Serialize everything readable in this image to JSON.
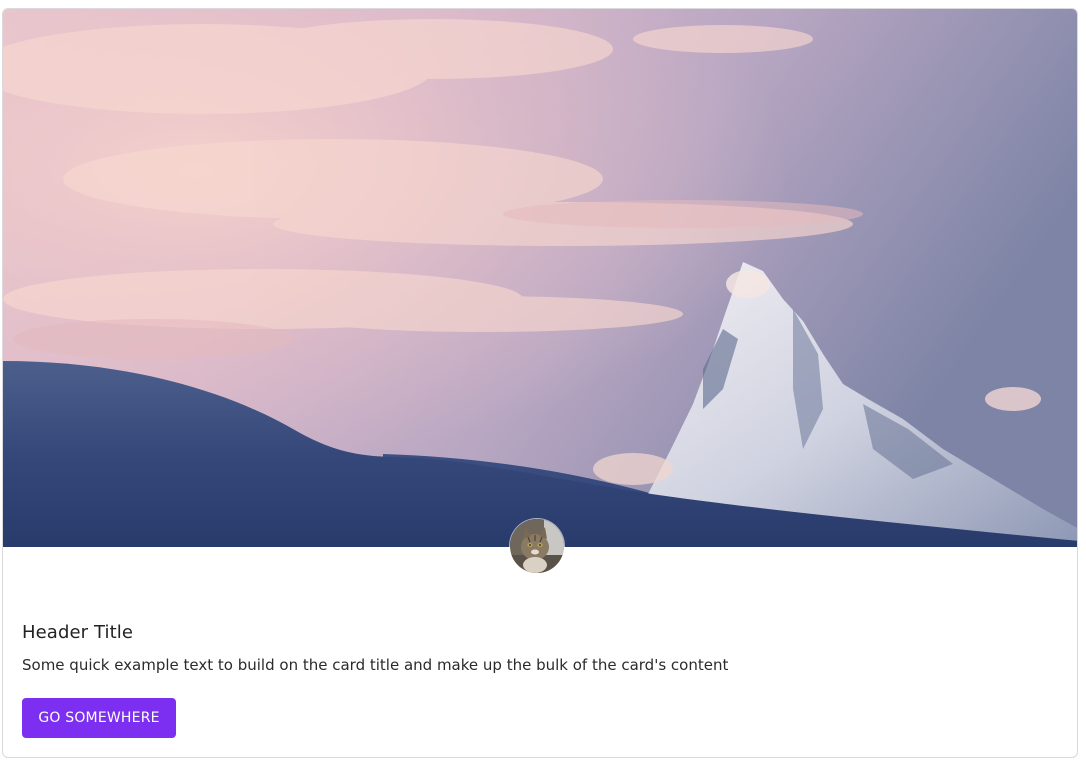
{
  "card": {
    "title": "Header Title",
    "text": "Some quick example text to build on the card title and make up the bulk of the card's content",
    "button_label": "GO SOMEWHERE"
  },
  "image": {
    "subject": "snow-mountain-peak-at-sunset"
  },
  "avatar": {
    "subject": "cat-photo"
  },
  "colors": {
    "accent": "#7c2ff0",
    "border": "#d9d9de",
    "title": "#222222",
    "text": "#2b2b2b"
  }
}
